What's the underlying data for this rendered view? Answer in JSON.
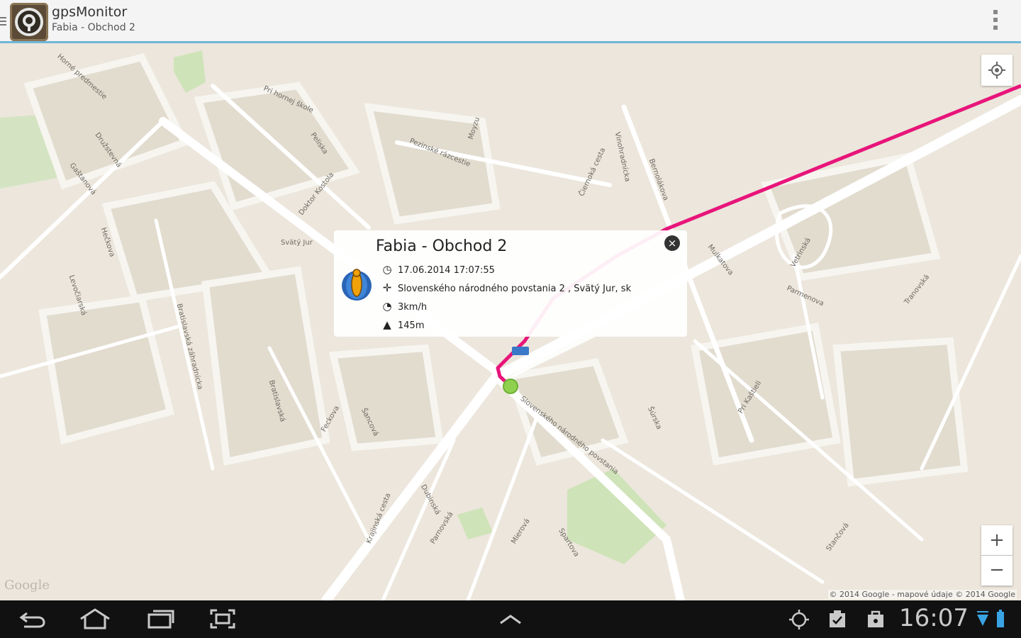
{
  "app": {
    "title": "gpsMonitor",
    "subtitle": "Fabia - Obchod 2"
  },
  "map": {
    "route_color": "#e8157a",
    "marker_color": "#8fd14f",
    "streets": [
      {
        "label": "Horné predmestie"
      },
      {
        "label": "Družstevná"
      },
      {
        "label": "Gaštanová"
      },
      {
        "label": "Pri hornej škole"
      },
      {
        "label": "Peliska"
      },
      {
        "label": "Pezinské rázcestie"
      },
      {
        "label": "Moyzu"
      },
      {
        "label": "Doktor Kostola"
      },
      {
        "label": "Čiernoká cesta"
      },
      {
        "label": "Vinohradníckа"
      },
      {
        "label": "Bernolákova"
      },
      {
        "label": "Hečkova"
      },
      {
        "label": "Levočiarská"
      },
      {
        "label": "Bratislavská záhradnícka"
      },
      {
        "label": "Bratislavská"
      },
      {
        "label": "Svätý Jur"
      },
      {
        "label": "Mulkatova"
      },
      {
        "label": "Vetrinská"
      },
      {
        "label": "Parmenova"
      },
      {
        "label": "Tranovská"
      },
      {
        "label": "Slovenského národného povstania"
      },
      {
        "label": "Feckova"
      },
      {
        "label": "Šancová"
      },
      {
        "label": "Šúrska"
      },
      {
        "label": "Pri Kaštieli"
      },
      {
        "label": "Dubinská"
      },
      {
        "label": "Krajinská cesta"
      },
      {
        "label": "Parnovská"
      },
      {
        "label": "Mierová"
      },
      {
        "label": "Spartova"
      },
      {
        "label": "Stančová"
      }
    ],
    "attribution": "© 2014 Google - mapové údaje © 2014 Google",
    "google_logo": "Google"
  },
  "info_window": {
    "title": "Fabia - Obchod 2",
    "datetime": "17.06.2014 17:07:55",
    "address": "Slovenského národného povstania 2 , Svätý Jur, sk",
    "speed": "3km/h",
    "altitude": "145m",
    "icons": [
      "clock-icon",
      "crosshair-icon",
      "speedometer-icon",
      "mountain-icon"
    ]
  },
  "controls": {
    "zoom_in": "+",
    "zoom_out": "−"
  },
  "status_bar": {
    "time": "16:07"
  }
}
